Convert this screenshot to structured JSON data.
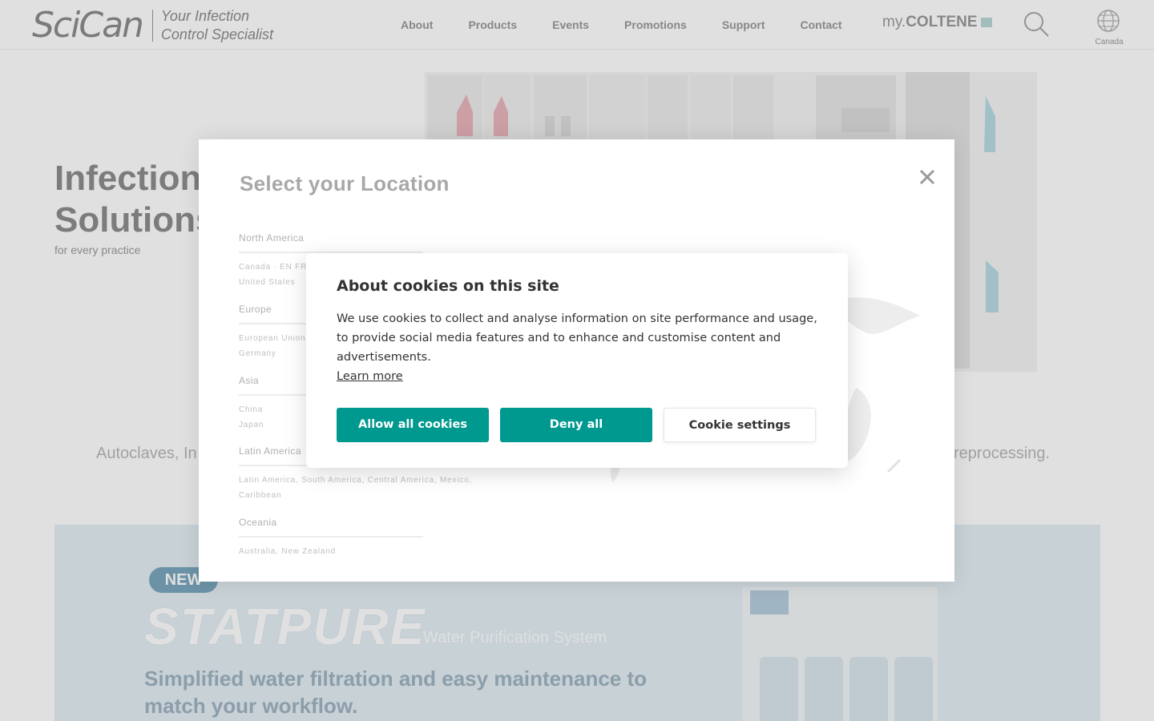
{
  "header": {
    "logo_word": "SciCan",
    "logo_tagline_line1": "Your Infection",
    "logo_tagline_line2": "Control Specialist",
    "nav": [
      "About",
      "Products",
      "Events",
      "Promotions",
      "Support",
      "Contact"
    ],
    "mycoltene_prefix": "my.",
    "mycoltene_brand": "COLTENE",
    "region": "Canada"
  },
  "hero": {
    "title_line1": "Infection",
    "title_line2": "Solutions",
    "subtitle": "for every practice",
    "tagline_left": "Autoclaves, In",
    "tagline_right": "reprocessing."
  },
  "promo": {
    "badge": "NEW",
    "product": "STATPURE",
    "product_sub": "Water Purification System",
    "text": "Simplified water filtration and easy maintenance to match  your workflow."
  },
  "location_modal": {
    "title": "Select your Location",
    "regions": [
      {
        "name": "North America",
        "countries_line1": "Canada  ·  EN  FR",
        "countries_line2": "United States"
      },
      {
        "name": "Europe",
        "countries_line1": "European Union",
        "countries_line2": "Germany"
      },
      {
        "name": "Asia",
        "countries_line1": "China",
        "countries_line2": "Japan"
      },
      {
        "name": "Latin America",
        "countries_line1": "Latin America, South America, Central America, Mexico,",
        "countries_line2": "Caribbean"
      },
      {
        "name": "Oceania",
        "countries_line1": "Australia, New Zealand",
        "countries_line2": ""
      }
    ]
  },
  "cookie": {
    "title": "About cookies on this site",
    "body": "We use cookies to collect and analyse information on site performance and usage, to provide social media features and to enhance and customise content and advertisements.",
    "learn_more": "Learn more",
    "allow_all": "Allow all cookies",
    "deny_all": "Deny all",
    "settings": "Cookie settings"
  },
  "colors": {
    "accent": "#00998f",
    "text": "#333333",
    "muted": "#9a9a9a"
  }
}
